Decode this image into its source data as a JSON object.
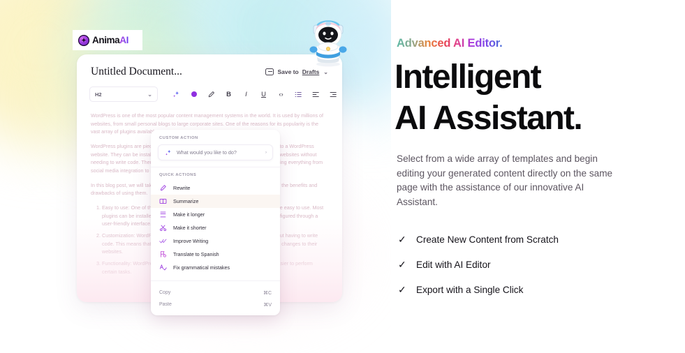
{
  "brand": {
    "name_dark": "Anima",
    "name_accent": "AI",
    "logo_icon": "sparkle-orb-icon",
    "mascot_icon": "robot-mascot-icon"
  },
  "editor": {
    "doc_title": "Untitled Document...",
    "save_label": "Save to ",
    "save_link": "Drafts",
    "save_chevron": "⌄",
    "folder_icon": "folder-icon",
    "block_style": "H2",
    "block_style_chevron": "⌄",
    "toolbar_icons": [
      {
        "name": "ai-sparkle-icon",
        "glyph": "✦"
      },
      {
        "name": "highlight-color-dot-icon",
        "glyph": ""
      },
      {
        "name": "highlighter-pen-icon",
        "glyph": "✎"
      },
      {
        "name": "bold-icon",
        "glyph": "B"
      },
      {
        "name": "italic-icon",
        "glyph": "I"
      },
      {
        "name": "underline-icon",
        "glyph": "U"
      },
      {
        "name": "code-icon",
        "glyph": "‹›"
      },
      {
        "name": "bullet-list-icon",
        "glyph": "☰"
      },
      {
        "name": "align-left-icon",
        "glyph": "⇤"
      },
      {
        "name": "align-right-icon",
        "glyph": "⇥"
      }
    ],
    "body": {
      "p1": "WordPress is one of the most popular content management systems in the world. It is used by millions of websites, from small personal blogs to large corporate sites. One of the reasons for its popularity is the vast array of plugins available.",
      "p2": "WordPress plugins are pieces of software that add specific features and functionality to a WordPress website. They can be installed and activated easily, allowing users to customize their websites without needing to write code. There are thousands of plugins available for WordPress, covering everything from social media integration to search engine optimization (SEO).",
      "p3": "In this blog post, we will take a closer look at WordPress plugins and discuss some of the benefits and drawbacks of using them.",
      "list": [
        "Easy to use: One of the biggest advantages of WordPress plugins is that they are easy to use. Most plugins can be installed and activated with just a few clicks, and they can be configured through a user-friendly interface.",
        "Customization: WordPress plugins allow users to customize their websites without having to write code. This means that even users with little to no technical knowledge can make changes to their websites.",
        "Functionality: WordPress plugins add specific features to a website, making it easier to perform certain tasks."
      ]
    }
  },
  "context_menu": {
    "custom_action_header": "CUSTOM ACTION",
    "custom_action_placeholder": "What would you like to do?",
    "custom_action_icon": "ai-sparkle-icon",
    "custom_action_caret": "›",
    "quick_actions_header": "QUICK ACTIONS",
    "quick_actions": [
      {
        "label": "Rewrite",
        "icon": "pencil-edit-icon",
        "active": false
      },
      {
        "label": "Summarize",
        "icon": "book-columns-icon",
        "active": true
      },
      {
        "label": "Make it longer",
        "icon": "expand-down-icon",
        "active": false
      },
      {
        "label": "Make it shorter",
        "icon": "scissors-icon",
        "active": false
      },
      {
        "label": "Improve Writing",
        "icon": "double-check-icon",
        "active": false
      },
      {
        "label": "Translate to Spanish",
        "icon": "translate-flag-icon",
        "active": false
      },
      {
        "label": "Fix grammatical mistakes",
        "icon": "spellcheck-icon",
        "active": false
      }
    ],
    "clipboard": [
      {
        "label": "Copy",
        "shortcut": "⌘C"
      },
      {
        "label": "Paste",
        "shortcut": "⌘V"
      }
    ]
  },
  "hero": {
    "eyebrow": "Advanced AI Editor.",
    "headline_line1": "Intelligent",
    "headline_line2": "AI Assistant.",
    "paragraph": "Select from a wide array of templates and begin editing your generated content directly on the same page with the assistance of our innovative AI Assistant.",
    "features": [
      {
        "label": "Create New Content from Scratch",
        "tick": "✓"
      },
      {
        "label": "Edit with AI Editor",
        "tick": "✓"
      },
      {
        "label": "Export with a Single Click",
        "tick": "✓"
      }
    ]
  },
  "colors": {
    "accent_purple": "#8f2fe0",
    "text_dark": "#0b0b0d",
    "body_gray": "#5c5560",
    "doc_text_faded": "#d9b9c6"
  }
}
